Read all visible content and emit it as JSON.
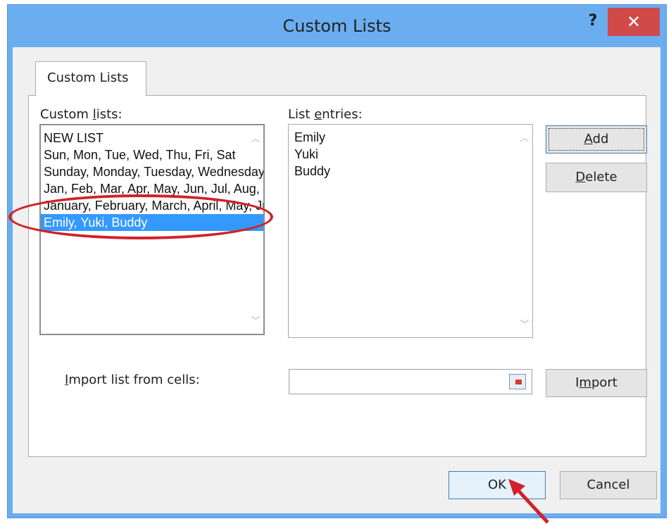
{
  "dialog": {
    "title": "Custom Lists",
    "help_glyph": "?",
    "close_glyph": "✕"
  },
  "tab": {
    "label": "Custom Lists"
  },
  "custom_lists": {
    "label_pre": "Custom ",
    "label_accel": "l",
    "label_post": "ists:",
    "items": [
      "NEW LIST",
      "Sun, Mon, Tue, Wed, Thu, Fri, Sat",
      "Sunday, Monday, Tuesday, Wednesday, Thursday, Friday, Saturday",
      "Jan, Feb, Mar, Apr, May, Jun, Jul, Aug, Sep, Oct, Nov, Dec",
      "January, February, March, April, May, June, July, August, September, October, November, December",
      "Emily, Yuki, Buddy"
    ],
    "selected_index": 5
  },
  "list_entries": {
    "label_pre": "List ",
    "label_accel": "e",
    "label_post": "ntries:",
    "items": [
      "Emily",
      "Yuki",
      "Buddy"
    ]
  },
  "buttons": {
    "add": {
      "accel": "A",
      "rest": "dd"
    },
    "delete": {
      "accel": "D",
      "rest": "elete"
    },
    "import": {
      "pre": "I",
      "accel": "m",
      "rest": "port"
    },
    "ok": "OK",
    "cancel": "Cancel"
  },
  "import_cells": {
    "accel": "I",
    "rest": "mport list from cells:",
    "value": ""
  },
  "colors": {
    "title_bar": "#6aaef0",
    "close_button": "#d04a4a",
    "selection": "#3399ff",
    "annotation": "#d0222a"
  },
  "icons": {
    "help": "help-icon",
    "close": "close-icon",
    "range_select": "range-select-icon",
    "arrow": "pointer-arrow-icon"
  }
}
